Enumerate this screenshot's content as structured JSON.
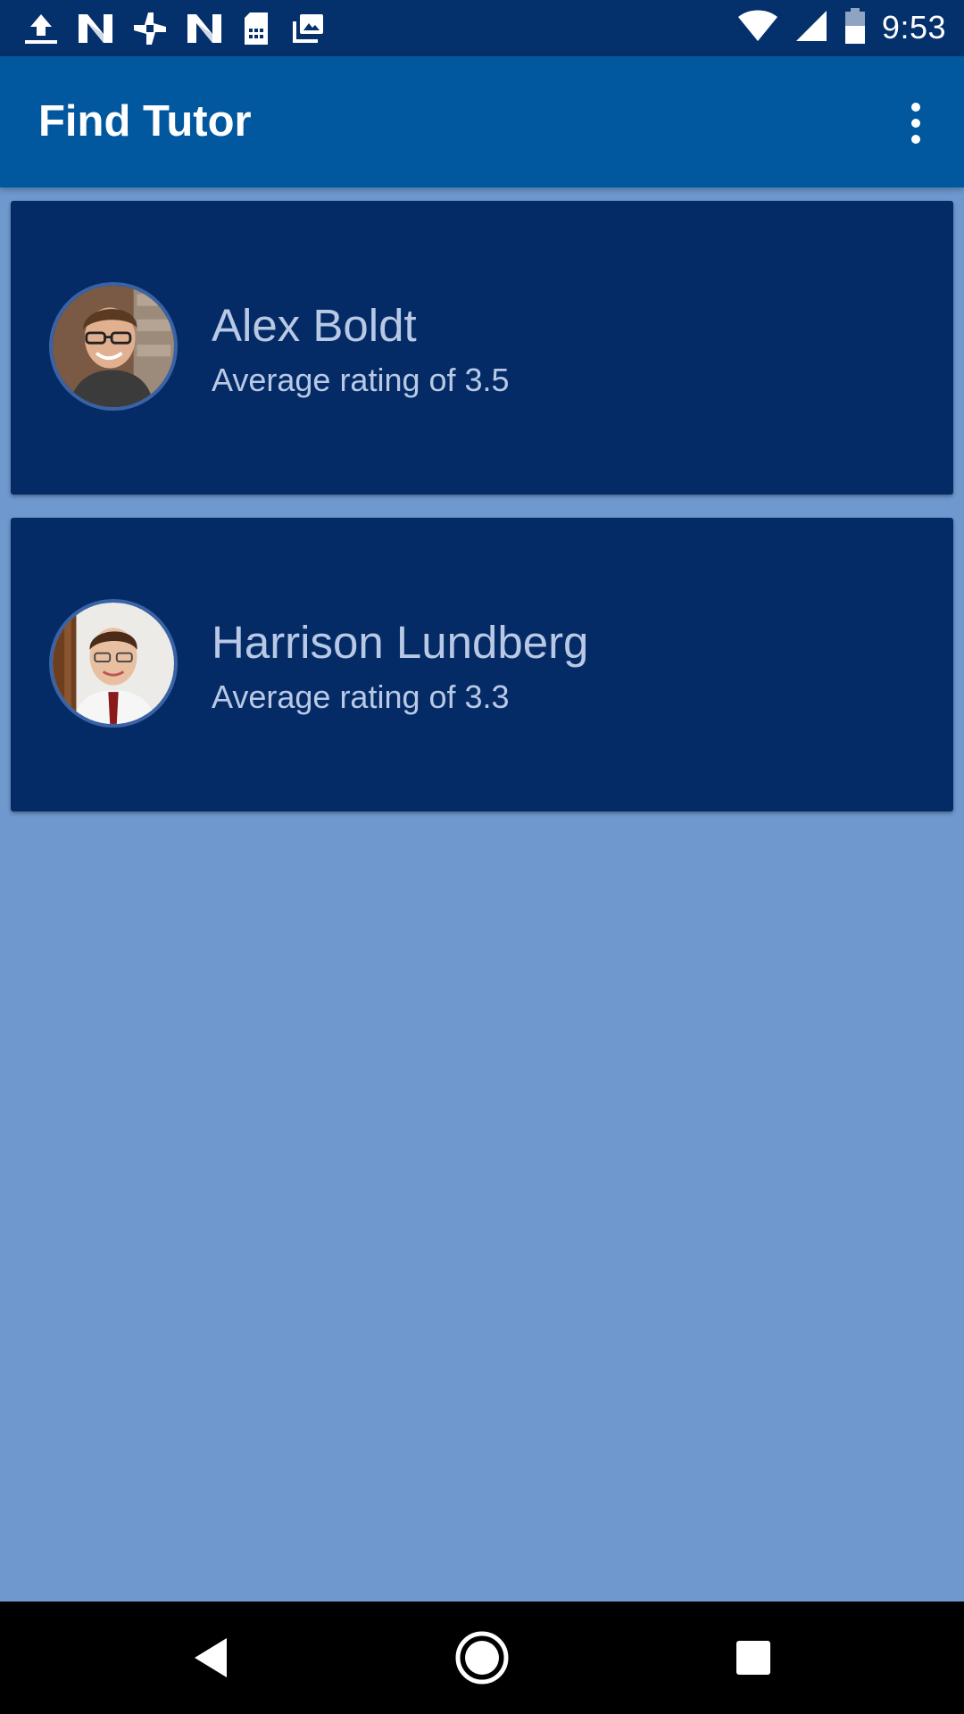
{
  "status_bar": {
    "time": "9:53",
    "left_icons": [
      "upload-icon",
      "n-app-icon",
      "pinwheel-icon",
      "n-app-icon",
      "sim-card-icon",
      "photo-stack-icon"
    ],
    "right_icons": [
      "wifi-icon",
      "cell-signal-icon",
      "battery-icon"
    ]
  },
  "app_bar": {
    "title": "Find Tutor",
    "menu_icon": "more-vert-icon"
  },
  "tutors": [
    {
      "name": "Alex Boldt",
      "rating_text": "Average rating of 3.5"
    },
    {
      "name": "Harrison Lundberg",
      "rating_text": "Average rating of 3.3"
    }
  ],
  "nav_bar": {
    "buttons": [
      "back-icon",
      "home-icon",
      "recents-icon"
    ]
  },
  "colors": {
    "status_bar": "#04306b",
    "app_bar": "#02589f",
    "card": "#042b66",
    "background": "#6f98cf",
    "card_text": "#b9c9e5"
  }
}
